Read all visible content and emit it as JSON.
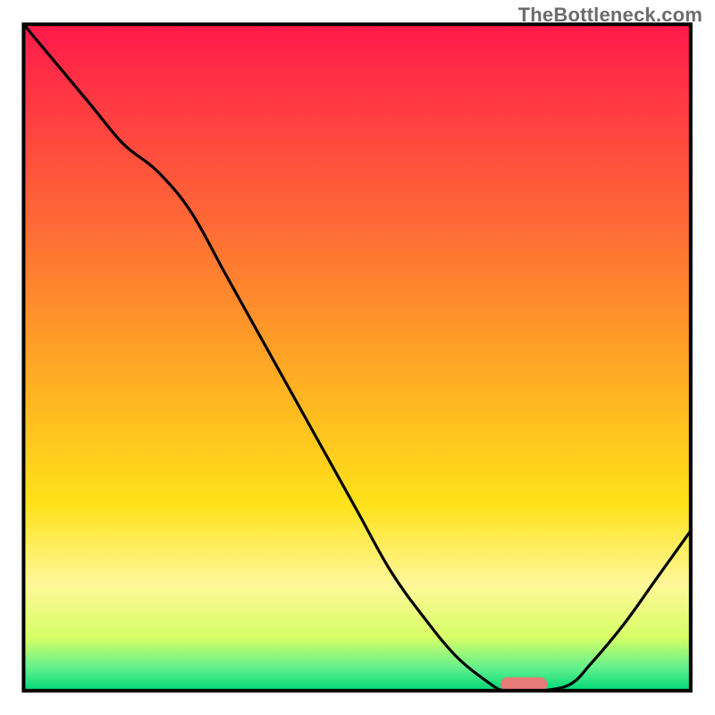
{
  "watermark": "TheBottleneck.com",
  "chart_data": {
    "type": "line",
    "title": "",
    "xlabel": "",
    "ylabel": "",
    "x": [
      0,
      5,
      10,
      15,
      20,
      25,
      30,
      35,
      40,
      45,
      50,
      55,
      60,
      65,
      70,
      72,
      75,
      78,
      82,
      85,
      90,
      95,
      100
    ],
    "values": [
      100,
      94,
      88,
      82,
      78,
      72,
      63,
      54,
      45,
      36,
      27,
      18,
      11,
      5,
      1,
      0,
      0,
      0,
      1,
      4,
      10,
      17,
      24
    ],
    "xlim": [
      0,
      100
    ],
    "ylim": [
      0,
      100
    ],
    "background_gradient_stops": [
      {
        "offset": 0.0,
        "color": "#ff1a4b"
      },
      {
        "offset": 0.3,
        "color": "#ff6a36"
      },
      {
        "offset": 0.55,
        "color": "#ffb322"
      },
      {
        "offset": 0.72,
        "color": "#ffe21a"
      },
      {
        "offset": 0.84,
        "color": "#fff79a"
      },
      {
        "offset": 0.92,
        "color": "#d7ff66"
      },
      {
        "offset": 0.965,
        "color": "#64f08c"
      },
      {
        "offset": 1.0,
        "color": "#00d977"
      }
    ],
    "marker": {
      "x_center": 75,
      "x_halfwidth": 3.5,
      "y": 0,
      "color": "#e87a78"
    },
    "frame": {
      "x": 3.3,
      "y": 3.4,
      "w": 93.3,
      "h": 93.2,
      "stroke": "#000000"
    }
  }
}
